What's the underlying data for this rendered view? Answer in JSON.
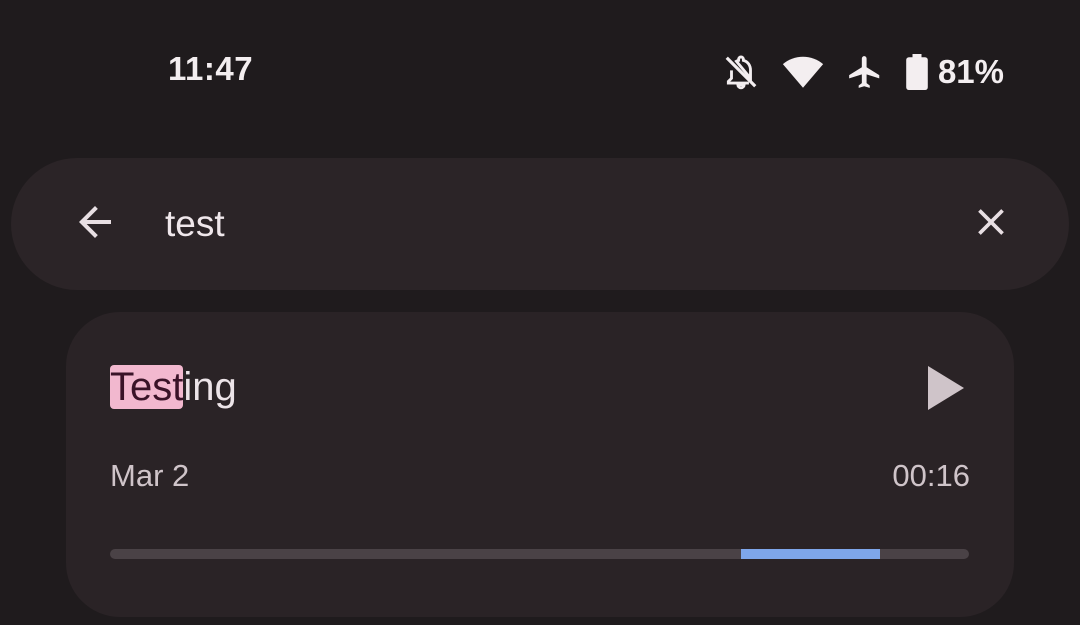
{
  "status_bar": {
    "time": "11:47",
    "battery_percent": "81%",
    "icons": [
      "notifications-off-icon",
      "wifi-icon",
      "airplane-mode-icon",
      "battery-icon"
    ]
  },
  "search": {
    "query": "test",
    "back_icon": "arrow-back-icon",
    "clear_icon": "close-icon"
  },
  "results": [
    {
      "title_highlight": "Test",
      "title_rest": "ing",
      "date": "Mar 2",
      "duration": "00:16",
      "match_start_fraction": 0.735,
      "match_end_fraction": 0.896,
      "play_icon": "play-icon"
    }
  ],
  "colors": {
    "background": "#1f1b1d",
    "surface": "#2b2427",
    "highlight": "#f2b8cf",
    "match_bar": "#7ea6ea",
    "track": "#4a4246"
  }
}
